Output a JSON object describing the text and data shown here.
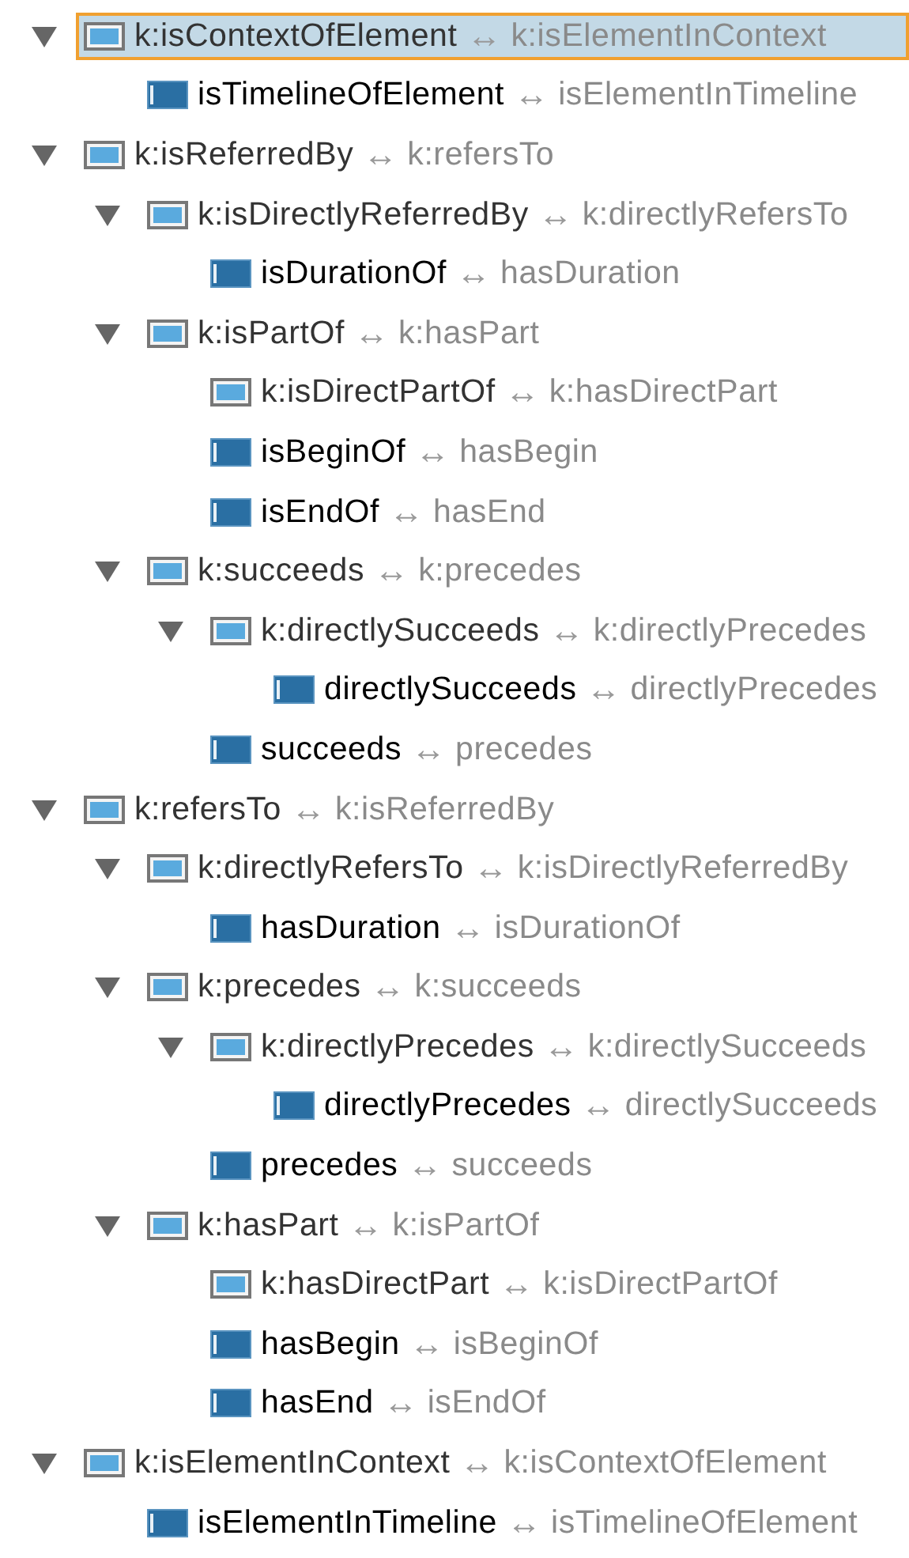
{
  "tree": [
    {
      "name": "k:isContextOfElement",
      "separator": "↔",
      "inverse": "k:isElementInContext",
      "kind": "inferred",
      "selected": true,
      "expanded": true,
      "children": [
        {
          "name": "isTimelineOfElement",
          "separator": "↔",
          "inverse": "isElementInTimeline",
          "kind": "asserted",
          "selected": false
        }
      ]
    },
    {
      "name": "k:isReferredBy",
      "separator": "↔",
      "inverse": "k:refersTo",
      "kind": "inferred",
      "selected": false,
      "expanded": true,
      "children": [
        {
          "name": "k:isDirectlyReferredBy",
          "separator": "↔",
          "inverse": "k:directlyRefersTo",
          "kind": "inferred",
          "selected": false,
          "expanded": true,
          "children": [
            {
              "name": "isDurationOf",
              "separator": "↔",
              "inverse": "hasDuration",
              "kind": "asserted",
              "selected": false
            }
          ]
        },
        {
          "name": "k:isPartOf",
          "separator": "↔",
          "inverse": "k:hasPart",
          "kind": "inferred",
          "selected": false,
          "expanded": true,
          "children": [
            {
              "name": "k:isDirectPartOf",
              "separator": "↔",
              "inverse": "k:hasDirectPart",
              "kind": "inferred",
              "selected": false
            },
            {
              "name": "isBeginOf",
              "separator": "↔",
              "inverse": "hasBegin",
              "kind": "asserted",
              "selected": false
            },
            {
              "name": "isEndOf",
              "separator": "↔",
              "inverse": "hasEnd",
              "kind": "asserted",
              "selected": false
            }
          ]
        },
        {
          "name": "k:succeeds",
          "separator": "↔",
          "inverse": "k:precedes",
          "kind": "inferred",
          "selected": false,
          "expanded": true,
          "children": [
            {
              "name": "k:directlySucceeds",
              "separator": "↔",
              "inverse": "k:directlyPrecedes",
              "kind": "inferred",
              "selected": false,
              "expanded": true,
              "children": [
                {
                  "name": "directlySucceeds",
                  "separator": "↔",
                  "inverse": "directlyPrecedes",
                  "kind": "asserted",
                  "selected": false
                }
              ]
            },
            {
              "name": "succeeds",
              "separator": "↔",
              "inverse": "precedes",
              "kind": "asserted",
              "selected": false
            }
          ]
        }
      ]
    },
    {
      "name": "k:refersTo",
      "separator": "↔",
      "inverse": "k:isReferredBy",
      "kind": "inferred",
      "selected": false,
      "expanded": true,
      "children": [
        {
          "name": "k:directlyRefersTo",
          "separator": "↔",
          "inverse": "k:isDirectlyReferredBy",
          "kind": "inferred",
          "selected": false,
          "expanded": true,
          "children": [
            {
              "name": "hasDuration",
              "separator": "↔",
              "inverse": "isDurationOf",
              "kind": "asserted",
              "selected": false
            }
          ]
        },
        {
          "name": "k:precedes",
          "separator": "↔",
          "inverse": "k:succeeds",
          "kind": "inferred",
          "selected": false,
          "expanded": true,
          "children": [
            {
              "name": "k:directlyPrecedes",
              "separator": "↔",
              "inverse": "k:directlySucceeds",
              "kind": "inferred",
              "selected": false,
              "expanded": true,
              "children": [
                {
                  "name": "directlyPrecedes",
                  "separator": "↔",
                  "inverse": "directlySucceeds",
                  "kind": "asserted",
                  "selected": false
                }
              ]
            },
            {
              "name": "precedes",
              "separator": "↔",
              "inverse": "succeeds",
              "kind": "asserted",
              "selected": false
            }
          ]
        },
        {
          "name": "k:hasPart",
          "separator": "↔",
          "inverse": "k:isPartOf",
          "kind": "inferred",
          "selected": false,
          "expanded": true,
          "children": [
            {
              "name": "k:hasDirectPart",
              "separator": "↔",
              "inverse": "k:isDirectPartOf",
              "kind": "inferred",
              "selected": false
            },
            {
              "name": "hasBegin",
              "separator": "↔",
              "inverse": "isBeginOf",
              "kind": "asserted",
              "selected": false
            },
            {
              "name": "hasEnd",
              "separator": "↔",
              "inverse": "isEndOf",
              "kind": "asserted",
              "selected": false
            }
          ]
        }
      ]
    },
    {
      "name": "k:isElementInContext",
      "separator": "↔",
      "inverse": "k:isContextOfElement",
      "kind": "inferred",
      "selected": false,
      "expanded": true,
      "children": [
        {
          "name": "isElementInTimeline",
          "separator": "↔",
          "inverse": "isTimelineOfElement",
          "kind": "asserted",
          "selected": false
        }
      ]
    }
  ]
}
